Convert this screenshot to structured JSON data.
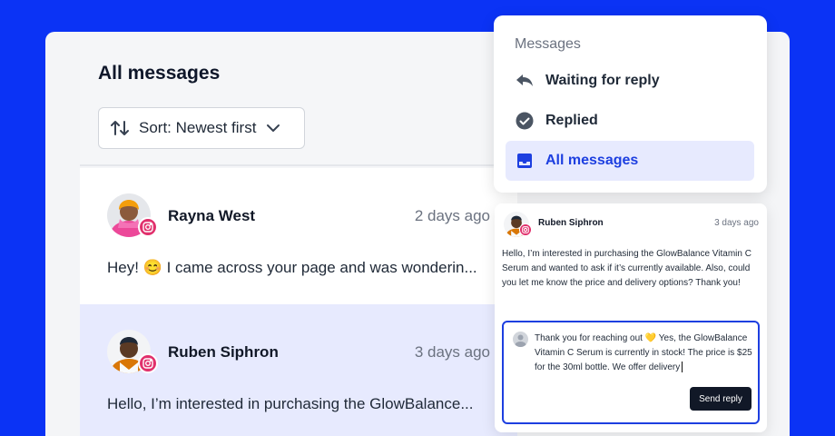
{
  "list": {
    "title": "All messages",
    "sort_label": "Sort: Newest first",
    "rows": [
      {
        "name": "Rayna West",
        "time": "2 days ago",
        "snippet": "Hey! 😊 I came across your page and was wonderin...",
        "channel_icon": "instagram-icon",
        "selected": false
      },
      {
        "name": "Ruben Siphron",
        "time": "3 days ago",
        "snippet": "Hello, I’m interested in purchasing the GlowBalance...",
        "channel_icon": "instagram-icon",
        "selected": true
      }
    ]
  },
  "menu": {
    "title": "Messages",
    "items": [
      {
        "label": "Waiting for reply",
        "icon": "reply-arrow-icon",
        "active": false
      },
      {
        "label": "Replied",
        "icon": "check-circle-icon",
        "active": false
      },
      {
        "label": "All messages",
        "icon": "inbox-icon",
        "active": true
      }
    ]
  },
  "detail": {
    "name": "Ruben Siphron",
    "time": "3 days ago",
    "message": "Hello, I’m interested in purchasing the GlowBalance Vitamin C Serum and wanted to ask if it’s currently available. Also, could you let me know the price and delivery options? Thank you!",
    "reply_draft": "Thank you for reaching out 💛 Yes, the GlowBalance Vitamin C Serum is currently in stock! The price is $25 for the 30ml bottle. We offer delivery",
    "send_label": "Send reply"
  },
  "colors": {
    "background": "#0b33f5",
    "accent": "#1d3fe0",
    "selected_row": "#e7eafe",
    "instagram": "#e1306c"
  }
}
